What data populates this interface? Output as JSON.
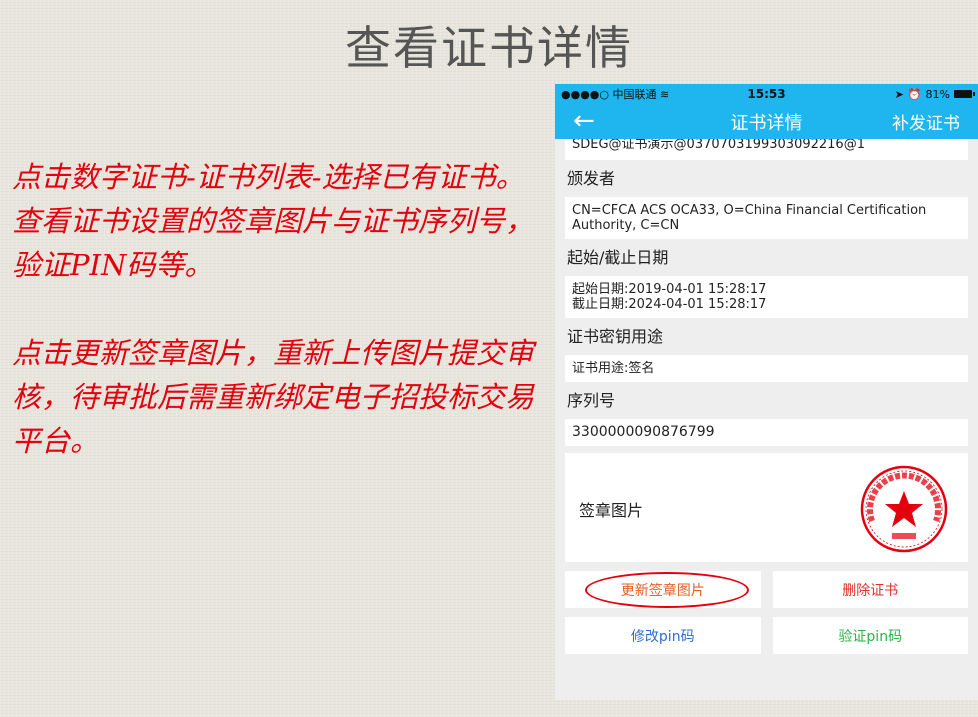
{
  "slide": {
    "title": "查看证书详情",
    "paragraph1": "点击数字证书-证书列表-选择已有证书。查看证书设置的签章图片与证书序列号，验证PIN码等。",
    "paragraph2": "点击更新签章图片，重新上传图片提交审核，待审批后需重新绑定电子招投标交易平台。"
  },
  "status_bar": {
    "carrier": "●●●●○ 中国联通",
    "time": "15:53",
    "battery": "81%"
  },
  "nav": {
    "back_icon": "arrow-left-icon",
    "title": "证书详情",
    "action": "补发证书"
  },
  "details": {
    "subject": "SDEG@证书演示@0370703199303092216@1",
    "issuer_label": "颁发者",
    "issuer_value": "CN=CFCA ACS OCA33, O=China Financial Certification Authority, C=CN",
    "validity_label": "起始/截止日期",
    "start_date": "起始日期:2019-04-01 15:28:17",
    "end_date": "截止日期:2024-04-01 15:28:17",
    "usage_label": "证书密钥用途",
    "usage_value": "证书用途:签名",
    "serial_label": "序列号",
    "serial_value": "3300000090876799",
    "seal_label": "签章图片"
  },
  "buttons": {
    "update_seal": "更新签章图片",
    "delete_cert": "删除证书",
    "change_pin": "修改pin码",
    "verify_pin": "验证pin码"
  },
  "colors": {
    "accent": "#1fb5ee",
    "instruction_text": "#e3000f",
    "delete": "#e0302c",
    "change_pin": "#2a6fd6",
    "verify_pin": "#2bb24c"
  }
}
